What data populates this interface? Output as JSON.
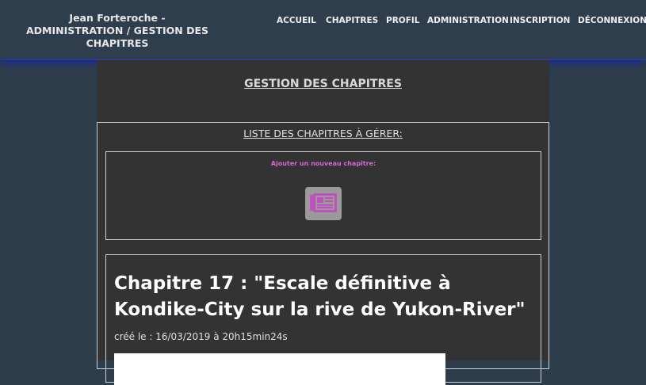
{
  "header": {
    "site_title": "Jean Forteroche - ADMINISTRATION / GESTION DES CHAPITRES",
    "nav": [
      {
        "label": "ACCUEIL"
      },
      {
        "label": "CHAPITRES"
      },
      {
        "label": "PROFIL"
      },
      {
        "label": "ADMINISTRATION"
      },
      {
        "label": "INSCRIPTION"
      },
      {
        "label": "DÉCONNEXION"
      }
    ]
  },
  "main": {
    "title": "GESTION DES CHAPITRES",
    "list_title": "LISTE DES CHAPITRES À GÉRER:",
    "add_label": "Ajouter un nouveau chapitre:",
    "add_icon": "newspaper-icon",
    "chapter": {
      "title": "Chapitre 17 : \"Escale définitive à Kondike-City sur la rive de Yukon-River\"",
      "date": "créé le : 16/03/2019 à 20h15min24s"
    }
  },
  "colors": {
    "accent": "#d568d5",
    "header_bg": "#2f3e4c",
    "page_bg": "#333333"
  }
}
